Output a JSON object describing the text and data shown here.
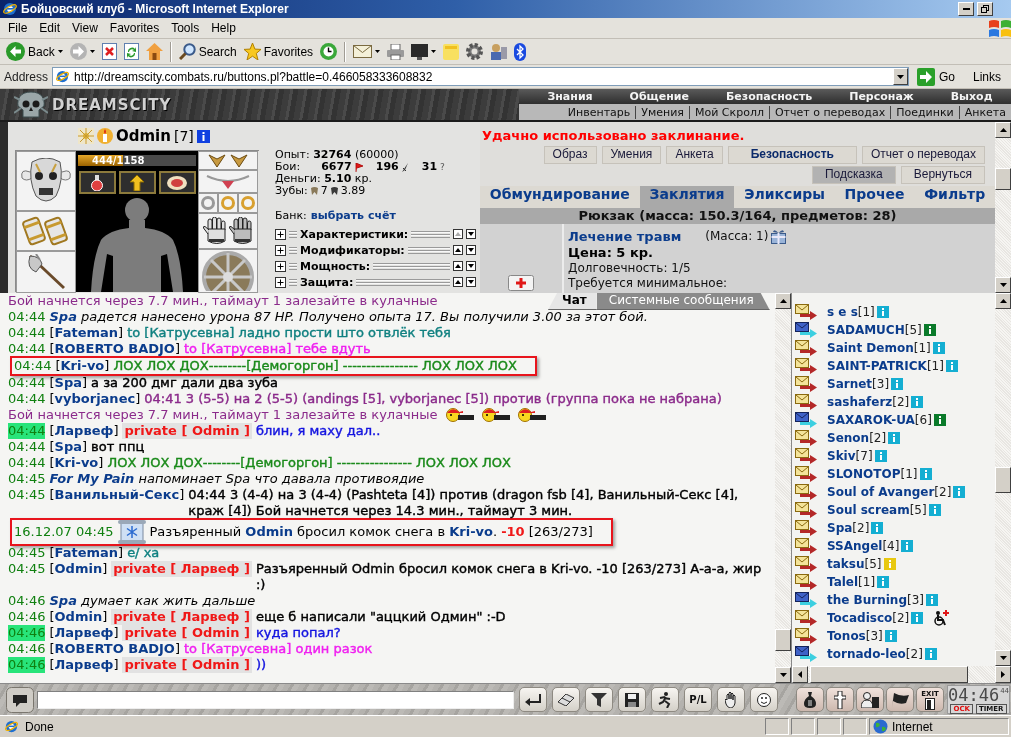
{
  "window": {
    "title": "Бойцовский клуб - Microsoft Internet Explorer"
  },
  "menu": [
    "File",
    "Edit",
    "View",
    "Favorites",
    "Tools",
    "Help"
  ],
  "toolbar": {
    "back": "Back",
    "search": "Search",
    "favorites": "Favorites"
  },
  "address": {
    "label": "Address",
    "url": "http://dreamscity.combats.ru/buttons.pl?battle=0.466058333608832",
    "go": "Go",
    "links": "Links"
  },
  "game_header": {
    "logo": "DREAMSCITY",
    "nav_main": [
      "Знания",
      "Общение",
      "Безопасность",
      "Персонаж",
      "Выход"
    ],
    "nav_sub": [
      "Инвентарь",
      "Умения",
      "Мой Скролл",
      "Отчет о переводах",
      "Поединки",
      "Анкета"
    ]
  },
  "character": {
    "name": "Odmin",
    "level": "[7]",
    "hp": {
      "reading": "444/1158",
      "level": 0.38
    },
    "stats": [
      {
        "kind": "text",
        "text": "Опыт: **32764** (60000)"
      },
      {
        "kind": "battles",
        "label": "Бои:",
        "wins": "6677",
        "losses": "196",
        "draws": "31",
        "draws_mark": "?"
      },
      {
        "kind": "text",
        "text": "Деньги: **5.10** кр."
      },
      {
        "kind": "teeth",
        "label": "Зубы:",
        "values": [
          "7",
          "3.89"
        ]
      }
    ],
    "bank": {
      "label": "Банк:",
      "link": "выбрать счёт"
    },
    "sections": [
      {
        "label": "Характеристики:",
        "expanded": false
      },
      {
        "label": "Модификаторы:",
        "expanded": false
      },
      {
        "label": "Мощность:",
        "expanded": false
      },
      {
        "label": "Защита:",
        "expanded": false
      }
    ]
  },
  "inventory": {
    "notice": "Удачно использовано заклинание.",
    "buttons": [
      {
        "label": "Образ",
        "bold": false
      },
      {
        "label": "Умения",
        "bold": false
      },
      {
        "label": "Анкета",
        "bold": false
      },
      {
        "label": "Безопасность",
        "bold": true
      },
      {
        "label": "Отчет о переводах",
        "bold": false
      }
    ],
    "nav_buttons": [
      {
        "label": "Подсказка",
        "selected": true
      },
      {
        "label": "Вернуться",
        "selected": false
      }
    ],
    "tabs": [
      {
        "label": "Обмундирование",
        "selected": false
      },
      {
        "label": "Заклятия",
        "selected": true
      },
      {
        "label": "Эликсиры",
        "selected": false
      },
      {
        "label": "Прочее",
        "selected": false
      },
      {
        "label": "Фильтр",
        "selected": false
      }
    ],
    "backpack": {
      "title": "Рюкзак (масса: 150.3/164, предметов: 28)",
      "item": {
        "name": "Лечение травм",
        "mass": "(Масса: 1)",
        "gift": true,
        "price": "Цена: 5 кр.",
        "durability": "Долговечность: 1/5",
        "requirement": "Требуется минимальное:"
      }
    }
  },
  "chat": {
    "tabs": [
      {
        "label": "Чат",
        "selected": true
      },
      {
        "label": "Системные сообщения",
        "selected": false
      }
    ],
    "messages": [
      {
        "kind": "notice",
        "text": "Бой начнется через 7.7 мин., таймаут 1 залезайте в кулачные",
        "color": "#8b2b8b",
        "highlighted": false
      },
      {
        "kind": "action",
        "time": "04:44",
        "time_highlighted": false,
        "text": "**Spa** радется нанесено урона 87 HP. Получено опыта 17. Вы получили 3.00 за этот бой.",
        "highlighted": false
      },
      {
        "kind": "say",
        "time": "04:44",
        "time_highlighted": false,
        "sender": "[**Fateman**]",
        "text": "to [Катрусевна] ладно прости што отвлёк тебя",
        "color": "#108080",
        "highlighted": false
      },
      {
        "kind": "say",
        "time": "04:44",
        "time_highlighted": false,
        "sender": "[**ROBERTO BADJO**]",
        "text": "to [Катрусевна] тебе вдуть",
        "color": "#f020f0",
        "highlighted": false
      },
      {
        "kind": "say",
        "time": "04:44",
        "time_highlighted": false,
        "sender": "[**Kri-vo**]",
        "text": "ЛОХ ЛОХ ДОХ--------[Демогоргон] ---------------- ЛОХ ЛОХ ЛОХ",
        "color": "#1a8a1a",
        "highlighted": true
      },
      {
        "kind": "say",
        "time": "04:44",
        "time_highlighted": false,
        "sender": "[**Spa**]",
        "text": "а за 200 дмг дали два зуба",
        "color": "#000000",
        "highlighted": false
      },
      {
        "kind": "say",
        "time": "04:44",
        "time_highlighted": false,
        "sender": "[**vyborjanec**]",
        "text": "04:41 3 (5-5) на 2 (5-5) (andings [5], vyborjanec [5]) против (группа пока не набрана)",
        "color": "#8b2b8b",
        "highlighted": false
      },
      {
        "kind": "notice",
        "text": "Бой начнется через 7.7 мин., таймаут 1 залезайте в кулачные",
        "color": "#8b2b8b",
        "markers": [
          {
            "kind": "fighter"
          },
          {
            "kind": "fighter"
          },
          {
            "kind": "fighter"
          }
        ],
        "highlighted": false
      },
      {
        "kind": "say",
        "time": "04:44",
        "time_highlighted": true,
        "sender": "[**Ларвеф**]",
        "private": "private [ Odmin ]",
        "text": "блин, я маху дал..",
        "color": "#1414e0",
        "highlighted": false
      },
      {
        "kind": "say",
        "time": "04:44",
        "time_highlighted": false,
        "sender": "[**Spa**]",
        "text": "вот ппц",
        "color": "#000000",
        "highlighted": false
      },
      {
        "kind": "say",
        "time": "04:44",
        "time_highlighted": false,
        "sender": "[**Kri-vo**]",
        "text": "ЛОХ ЛОХ ДОХ--------[Демогоргон] ---------------- ЛОХ ЛОХ ЛОХ",
        "color": "#1a8a1a",
        "highlighted": false
      },
      {
        "kind": "action",
        "time": "04:45",
        "time_highlighted": false,
        "text": "**For My Pain** напоминает Spa что давала противоядие",
        "highlighted": false
      },
      {
        "kind": "say",
        "time": "04:45",
        "time_highlighted": false,
        "sender": "[**Ванильный-Секс**]",
        "text": "04:44 3 (4-4) на 3 (4-4) (Pashteta [4]) против (dragon fsb [4], Ванильный-Секс [4], краж [4]) Бой начнется через 14.3 мин., таймаут 3 мин.",
        "color": "#000000",
        "highlighted": false
      },
      {
        "kind": "spell",
        "time": "16.12.07 04:45",
        "time_highlighted": false,
        "text": "Разъяренный **Odmin** бросил комок снега в **Kri-vo**.",
        "damage": "-10",
        "hp": "[263/273]",
        "highlighted": true
      },
      {
        "kind": "say",
        "time": "04:45",
        "time_highlighted": false,
        "sender": "[**Fateman**]",
        "text": "е/ ха",
        "color": "#108080",
        "highlighted": false
      },
      {
        "kind": "say",
        "time": "04:45",
        "time_highlighted": false,
        "sender": "[**Odmin**]",
        "private": "private [ Ларвеф ]",
        "text": "Разъяренный Odmin бросил комок снега в Kri-vo. -10 [263/273] А-а-а, жир :)",
        "color": "#000000",
        "highlighted": false
      },
      {
        "kind": "action",
        "time": "04:46",
        "time_highlighted": false,
        "text": "**Spa** думает как жить дальше",
        "highlighted": false
      },
      {
        "kind": "say",
        "time": "04:46",
        "time_highlighted": false,
        "sender": "[**Odmin**]",
        "private": "private [ Ларвеф ]",
        "text": "еще б написали \"аццкий Одмин\" :-D",
        "color": "#000000",
        "highlighted": false
      },
      {
        "kind": "say",
        "time": "04:46",
        "time_highlighted": true,
        "sender": "[**Ларвеф**]",
        "private": "private [ Odmin ]",
        "text": "куда попал?",
        "color": "#1414e0",
        "highlighted": false
      },
      {
        "kind": "say",
        "time": "04:46",
        "time_highlighted": false,
        "sender": "[**ROBERTO BADJO**]",
        "text": "to [Катрусевна] один разок",
        "color": "#f020f0",
        "highlighted": false
      },
      {
        "kind": "say",
        "time": "04:46",
        "time_highlighted": true,
        "sender": "[**Ларвеф**]",
        "private": "private [ Odmin ]",
        "text": "))",
        "color": "#1414e0",
        "highlighted": false
      }
    ]
  },
  "users": [
    {
      "name": "s e s",
      "level": "[1]",
      "kind": "standard",
      "color": "#14aed2",
      "injured": false
    },
    {
      "name": "SADAMUCH",
      "level": "[5]",
      "kind": "accented",
      "color": "#0a7a2a",
      "injured": false
    },
    {
      "name": "Saint Demon",
      "level": "[1]",
      "kind": "standard",
      "color": "#14aed2",
      "injured": false
    },
    {
      "name": "SAINT-PATRICK",
      "level": "[1]",
      "kind": "standard",
      "color": "#14aed2",
      "injured": false
    },
    {
      "name": "Sarnet",
      "level": "[3]",
      "kind": "standard",
      "color": "#14aed2",
      "injured": false
    },
    {
      "name": "sashaferz",
      "level": "[2]",
      "kind": "standard",
      "color": "#14aed2",
      "injured": false
    },
    {
      "name": "SAXAROK-UA",
      "level": "[6]",
      "kind": "accented",
      "color": "#0a7a2a",
      "injured": false
    },
    {
      "name": "Senon",
      "level": "[2]",
      "kind": "standard",
      "color": "#14aed2",
      "injured": false
    },
    {
      "name": "Skiv",
      "level": "[7]",
      "kind": "standard",
      "color": "#14aed2",
      "injured": false
    },
    {
      "name": "SLONOTOP",
      "level": "[1]",
      "kind": "standard",
      "color": "#14aed2",
      "injured": false
    },
    {
      "name": "Soul of Avanger",
      "level": "[2]",
      "kind": "standard",
      "color": "#14aed2",
      "injured": false
    },
    {
      "name": "Soul scream",
      "level": "[5]",
      "kind": "standard",
      "color": "#14aed2",
      "injured": false
    },
    {
      "name": "Spa",
      "level": "[2]",
      "kind": "standard",
      "color": "#14aed2",
      "injured": false
    },
    {
      "name": "SSAngel",
      "level": "[4]",
      "kind": "standard",
      "color": "#14aed2",
      "injured": false
    },
    {
      "name": "taksu",
      "level": "[5]",
      "kind": "standard",
      "color": "#e8c810",
      "injured": false
    },
    {
      "name": "Talel",
      "level": "[1]",
      "kind": "standard",
      "color": "#14aed2",
      "injured": false
    },
    {
      "name": "the Burning",
      "level": "[3]",
      "kind": "accented",
      "color": "#14aed2",
      "injured": false
    },
    {
      "name": "Tocadisco",
      "level": "[2]",
      "kind": "standard",
      "color": "#14aed2",
      "injured": true
    },
    {
      "name": "Tonos",
      "level": "[3]",
      "kind": "standard",
      "color": "#14aed2",
      "injured": false
    },
    {
      "name": "tornado-leo",
      "level": "[2]",
      "kind": "accented",
      "color": "#14aed2",
      "injured": false
    }
  ],
  "bottom_bar": {
    "pl_label": "P/L",
    "exit_label": "EXIT",
    "clock": {
      "time": "04:46",
      "seconds": "44",
      "labels": [
        "OCK",
        "TIMER"
      ]
    }
  },
  "status_bar": {
    "text": "Done",
    "zone": "Internet"
  }
}
